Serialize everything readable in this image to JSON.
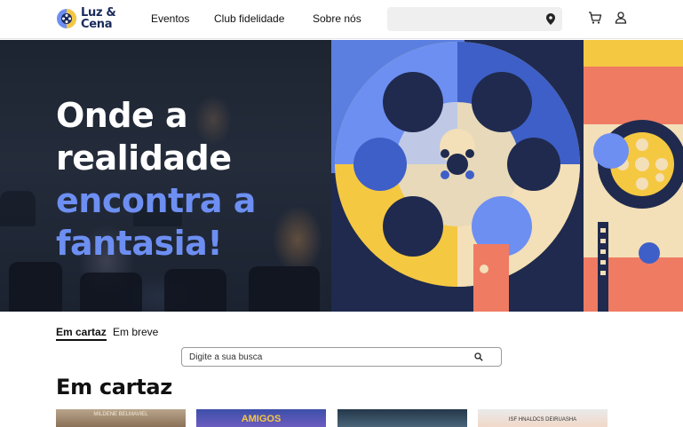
{
  "brand": {
    "line1": "Luz &",
    "line2": "Cena"
  },
  "nav": {
    "items": [
      {
        "label": "Eventos"
      },
      {
        "label": "Club fidelidade"
      },
      {
        "label": "Sobre nós"
      }
    ]
  },
  "header": {
    "location_icon": "map-pin-icon",
    "cart_icon": "cart-icon",
    "user_icon": "user-icon"
  },
  "hero": {
    "line1": "Onde a",
    "line2": "realidade",
    "line3": "encontra a",
    "line4": "fantasia!",
    "accent_color": "#6d8ff2"
  },
  "tabs": [
    {
      "label": "Em cartaz",
      "active": true
    },
    {
      "label": "Em breve",
      "active": false
    }
  ],
  "search": {
    "placeholder": "Digite a sua busca",
    "icon": "search-icon"
  },
  "section": {
    "title": "Em cartaz"
  },
  "posters": [
    {
      "top_text": "MILDENE BELMAVIEL"
    },
    {
      "top_text": "AMIGOS"
    },
    {
      "top_text": ""
    },
    {
      "top_text": "ISF HNALDCS DEIRUASHA"
    }
  ],
  "colors": {
    "navy": "#1a2a5c",
    "blue": "#6d8ff2",
    "yellow": "#f5c842",
    "coral": "#ef7b63",
    "cream": "#f3dfb8"
  }
}
